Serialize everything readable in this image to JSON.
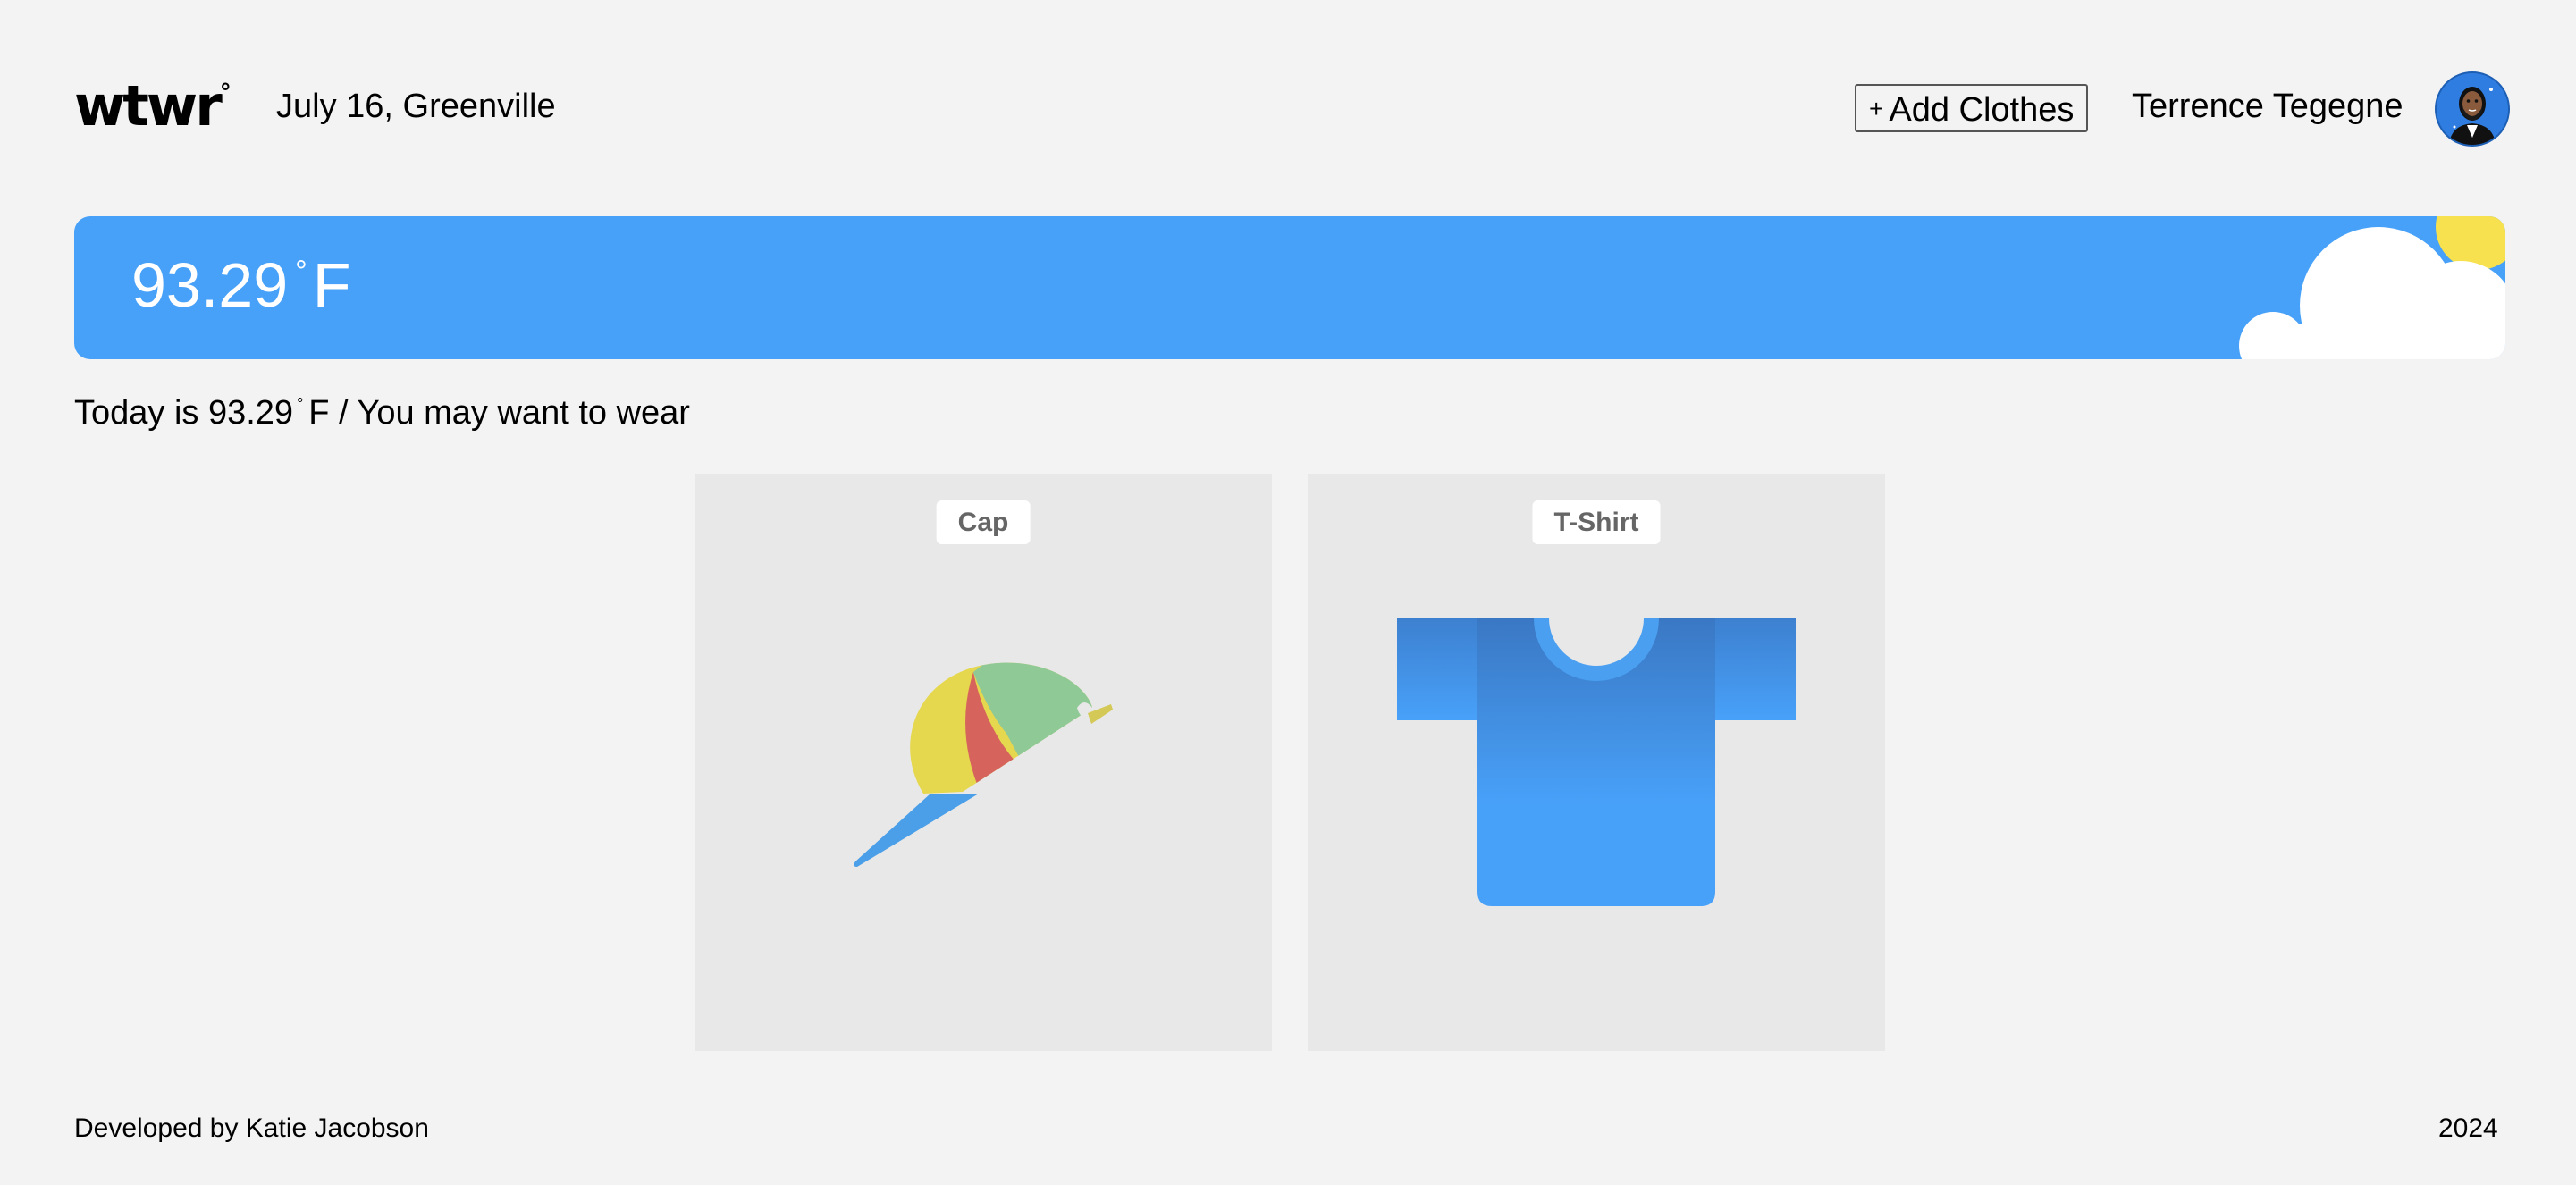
{
  "header": {
    "logo": "wtwr",
    "logo_degree": "°",
    "date_location": "July 16, Greenville",
    "add_clothes_plus": "+",
    "add_clothes_label": "Add Clothes",
    "username": "Terrence Tegegne",
    "avatar_icon": "user-avatar-icon"
  },
  "weather": {
    "temperature": "93.29",
    "degree_symbol": "°",
    "unit": "F",
    "condition_icon": "sun-cloud-icon",
    "banner_color": "#48a1f9"
  },
  "caption": {
    "prefix": "Today is 93.29",
    "degree_symbol": "°",
    "suffix": "F / You may want to wear"
  },
  "cards": [
    {
      "label": "Cap",
      "icon": "cap-icon"
    },
    {
      "label": "T-Shirt",
      "icon": "t-shirt-icon"
    }
  ],
  "footer": {
    "developer": "Developed by Katie Jacobson",
    "year": "2024"
  }
}
